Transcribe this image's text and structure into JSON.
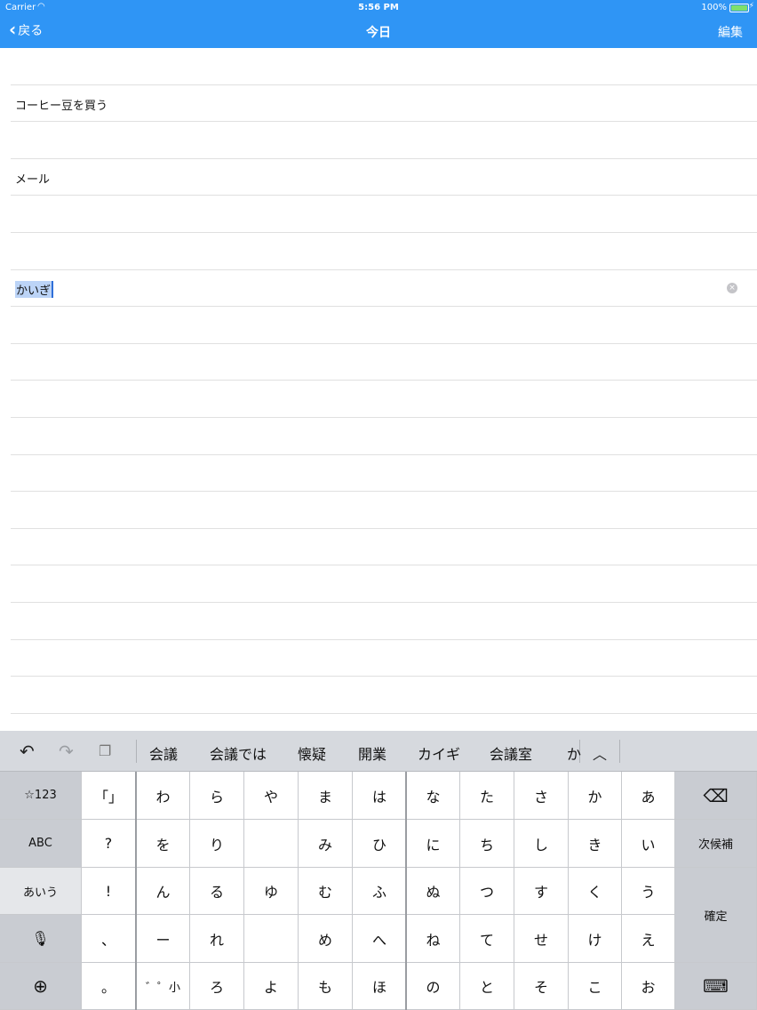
{
  "status": {
    "carrier": "Carrier",
    "time": "5:56 PM",
    "battery": "100%"
  },
  "nav": {
    "back": "戻る",
    "title": "今日",
    "edit": "編集"
  },
  "list": {
    "rows": [
      "",
      "コーヒー豆を買う",
      "",
      "メール",
      "",
      "",
      "かいぎ",
      "",
      "",
      "",
      "",
      "",
      "",
      "",
      "",
      "",
      "",
      ""
    ],
    "editing_row": 6
  },
  "keyboard": {
    "candidates": [
      "会議",
      "会議では",
      "懐疑",
      "開業",
      "カイギ",
      "会議室",
      "か"
    ],
    "left_keys": [
      "☆123",
      "ABC",
      "あいう",
      "",
      ""
    ],
    "punct_keys": [
      "「」",
      "?",
      "!",
      "、",
      "。"
    ],
    "kana_cols": [
      [
        "わ",
        "を",
        "ん",
        "ー",
        "゛゜小"
      ],
      [
        "ら",
        "り",
        "る",
        "れ",
        "ろ"
      ],
      [
        "や",
        "",
        "ゆ",
        "",
        "よ"
      ],
      [
        "ま",
        "み",
        "む",
        "め",
        "も"
      ],
      [
        "は",
        "ひ",
        "ふ",
        "へ",
        "ほ"
      ],
      [
        "な",
        "に",
        "ぬ",
        "ね",
        "の"
      ],
      [
        "た",
        "ち",
        "つ",
        "て",
        "と"
      ],
      [
        "さ",
        "し",
        "す",
        "せ",
        "そ"
      ],
      [
        "か",
        "き",
        "く",
        "け",
        "こ"
      ],
      [
        "あ",
        "い",
        "う",
        "え",
        "お"
      ]
    ],
    "next_candidate": "次候補",
    "confirm": "確定"
  }
}
